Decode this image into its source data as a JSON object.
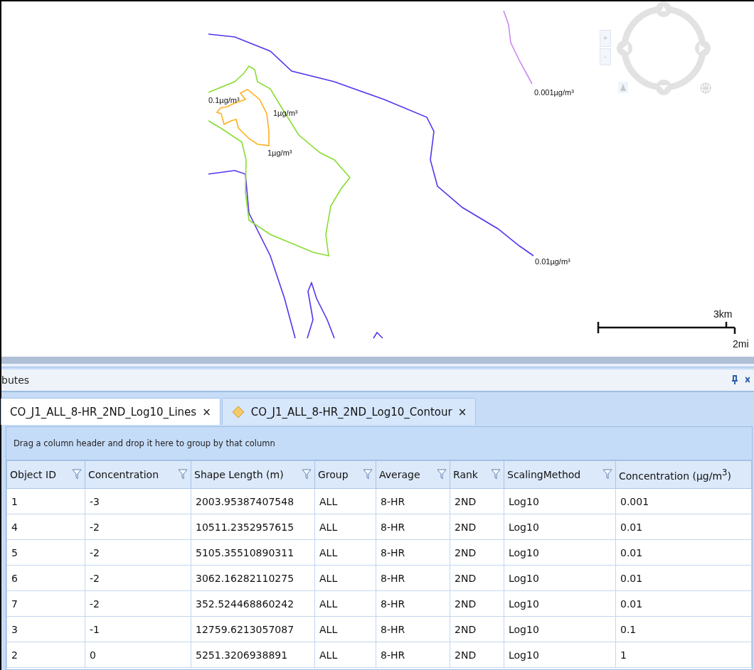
{
  "map": {
    "contour_labels": [
      {
        "text": "0.1µg/m³"
      },
      {
        "text": "1µg/m³"
      },
      {
        "text": "1µg/m³"
      },
      {
        "text": "0.001µg/m³"
      },
      {
        "text": "0.01µg/m³"
      }
    ],
    "zoom_buttons": [
      "+",
      "-"
    ],
    "scale_bar": {
      "km_label": "3km",
      "mi_label": "2mi"
    }
  },
  "panel": {
    "title": "butes"
  },
  "tabs": [
    {
      "label": "CO_J1_ALL_8-HR_2ND_Log10_Lines",
      "close": "×",
      "selected": true
    },
    {
      "label": "CO_J1_ALL_8-HR_2ND_Log10_Contour",
      "close": "×",
      "selected": false
    }
  ],
  "grid": {
    "group_hint": "Drag a column header and drop it here to group by that column",
    "columns": [
      {
        "label": "Object ID",
        "filter": true
      },
      {
        "label": "Concentration",
        "filter": true
      },
      {
        "label": "Shape Length (m)",
        "filter": true
      },
      {
        "label": "Group",
        "filter": true
      },
      {
        "label": "Average",
        "filter": true
      },
      {
        "label": "Rank",
        "filter": true
      },
      {
        "label": "ScalingMethod",
        "filter": true
      },
      {
        "label": "Concentration (µg/m$^{3}$)",
        "filter": false
      }
    ],
    "rows": [
      [
        "1",
        "-3",
        "2003.95387407548",
        "ALL",
        "8-HR",
        "2ND",
        "Log10",
        "0.001"
      ],
      [
        "4",
        "-2",
        "10511.2352957615",
        "ALL",
        "8-HR",
        "2ND",
        "Log10",
        "0.01"
      ],
      [
        "5",
        "-2",
        "5105.35510890311",
        "ALL",
        "8-HR",
        "2ND",
        "Log10",
        "0.01"
      ],
      [
        "6",
        "-2",
        "3062.16282110275",
        "ALL",
        "8-HR",
        "2ND",
        "Log10",
        "0.01"
      ],
      [
        "7",
        "-2",
        "352.524468860242",
        "ALL",
        "8-HR",
        "2ND",
        "Log10",
        "0.01"
      ],
      [
        "3",
        "-1",
        "12759.6213057087",
        "ALL",
        "8-HR",
        "2ND",
        "Log10",
        "0.1"
      ],
      [
        "2",
        "0",
        "5251.3206938891",
        "ALL",
        "8-HR",
        "2ND",
        "Log10",
        "1"
      ]
    ]
  }
}
